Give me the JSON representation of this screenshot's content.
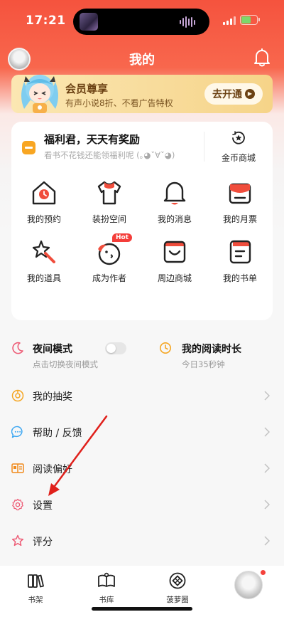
{
  "status_bar": {
    "time": "17:21"
  },
  "header": {
    "title": "我的"
  },
  "vip": {
    "title": "会员尊享",
    "subtitle": "有声小说8折、不看广告特权",
    "button": "去开通"
  },
  "welfare": {
    "title": "福利君，天天有奖励",
    "subtitle": "看书不花钱还能领福利呢 (｡◕ˇ∀ˇ◕)",
    "coin_mall": "金币商城"
  },
  "grid": [
    {
      "label": "我的预约",
      "icon": "calendar-house-icon"
    },
    {
      "label": "装扮空间",
      "icon": "tshirt-icon"
    },
    {
      "label": "我的消息",
      "icon": "bell-icon"
    },
    {
      "label": "我的月票",
      "icon": "ticket-icon"
    },
    {
      "label": "我的道具",
      "icon": "magic-wand-icon"
    },
    {
      "label": "成为作者",
      "icon": "bird-icon",
      "badge": "Hot"
    },
    {
      "label": "周边商城",
      "icon": "shopping-bag-icon"
    },
    {
      "label": "我的书单",
      "icon": "booklist-icon"
    }
  ],
  "features": {
    "night_mode": {
      "title": "夜间模式",
      "subtitle": "点击切换夜间模式",
      "enabled": false
    },
    "reading_time": {
      "title": "我的阅读时长",
      "subtitle": "今日35秒钟"
    }
  },
  "menu": [
    {
      "label": "我的抽奖",
      "icon": "lottery-icon"
    },
    {
      "label": "帮助 / 反馈",
      "icon": "chat-bubble-icon"
    },
    {
      "label": "阅读偏好",
      "icon": "open-book-icon"
    },
    {
      "label": "设置",
      "icon": "gear-icon"
    },
    {
      "label": "评分",
      "icon": "star-icon"
    }
  ],
  "tabs": [
    {
      "label": "书架",
      "icon": "bookshelf-icon"
    },
    {
      "label": "书库",
      "icon": "library-icon"
    },
    {
      "label": "菠萝圈",
      "icon": "pineapple-circle-icon"
    },
    {
      "label": "",
      "icon": "profile-avatar",
      "notification": true
    }
  ],
  "colors": {
    "accent": "#f5533e",
    "vip_gold": "#f8dc9c",
    "orange": "#f8a622",
    "annotation": "#e0201b"
  }
}
